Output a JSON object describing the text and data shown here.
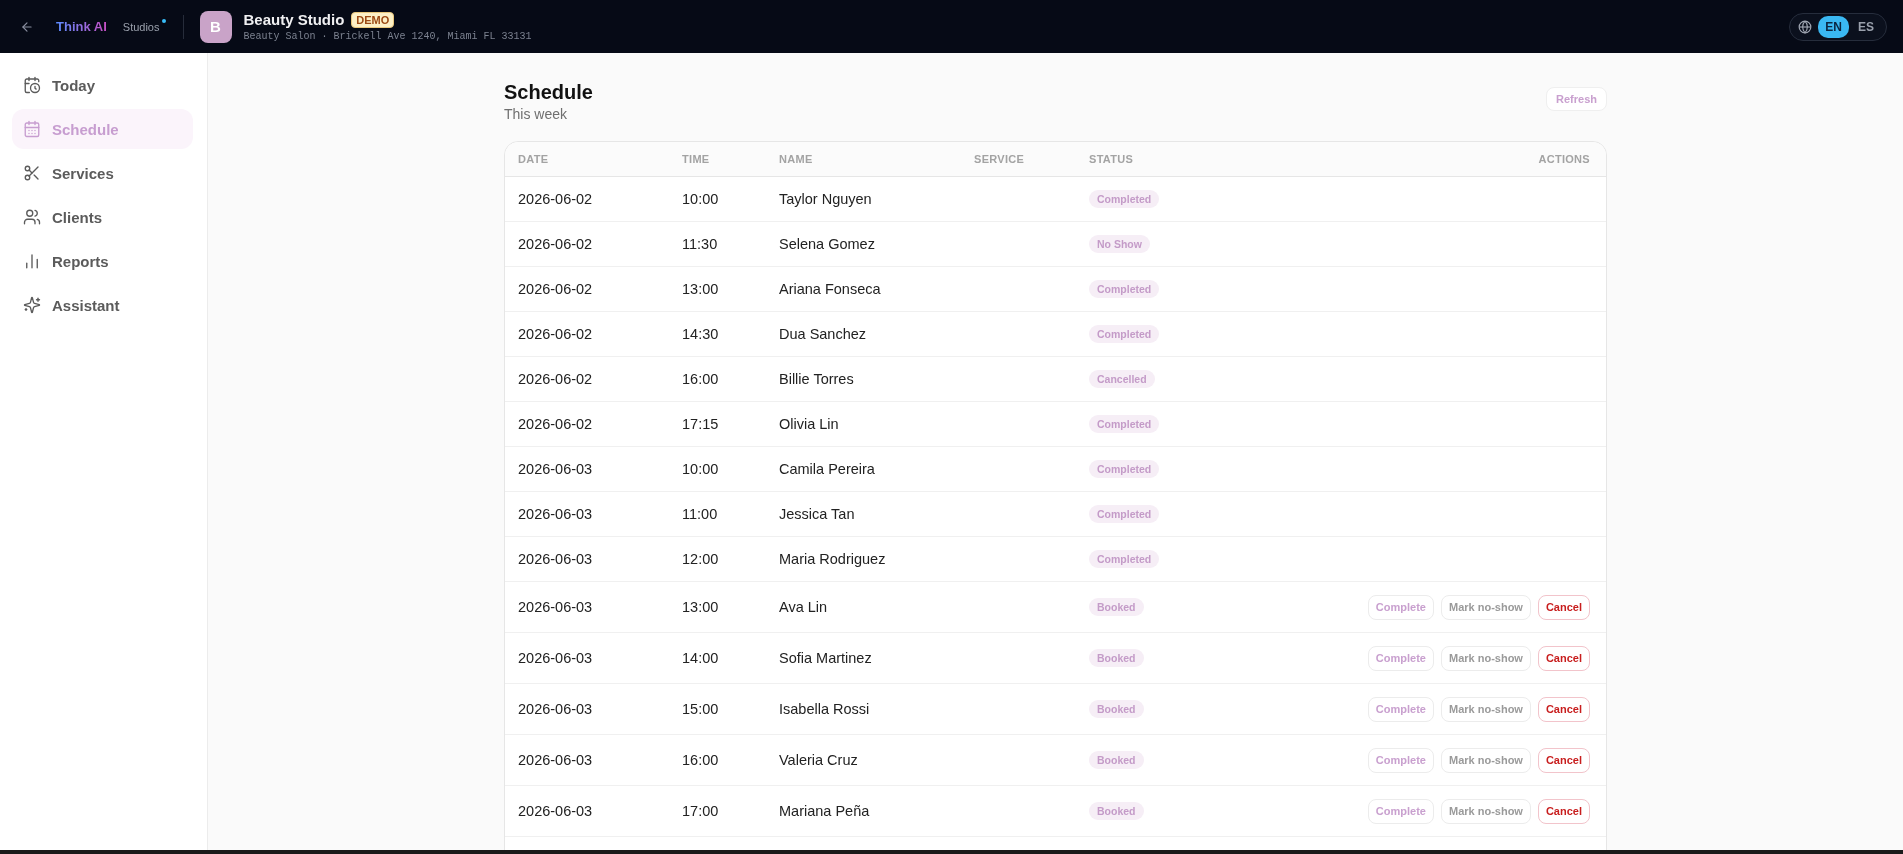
{
  "header": {
    "brand": "Think AI",
    "section": "Studios",
    "avatar_letter": "B",
    "business_name": "Beauty Studio",
    "badge": "DEMO",
    "subtitle": "Beauty Salon · Brickell Ave 1240, Miami FL 33131",
    "languages": [
      {
        "label": "EN",
        "selected": true
      },
      {
        "label": "ES",
        "selected": false
      }
    ]
  },
  "sidebar": {
    "items": [
      {
        "label": "Today",
        "selected": false
      },
      {
        "label": "Schedule",
        "selected": true
      },
      {
        "label": "Services",
        "selected": false
      },
      {
        "label": "Clients",
        "selected": false
      },
      {
        "label": "Reports",
        "selected": false
      },
      {
        "label": "Assistant",
        "selected": false
      }
    ]
  },
  "page": {
    "title": "Schedule",
    "subtitle": "This week",
    "refresh_button": "Refresh"
  },
  "table": {
    "columns": [
      "DATE",
      "TIME",
      "NAME",
      "SERVICE",
      "STATUS",
      "ACTIONS"
    ],
    "rows": [
      {
        "date": "2026-06-02",
        "time": "10:00",
        "name": "Taylor Nguyen",
        "status": "Completed"
      },
      {
        "date": "2026-06-02",
        "time": "11:30",
        "name": "Selena Gomez",
        "status": "No Show"
      },
      {
        "date": "2026-06-02",
        "time": "13:00",
        "name": "Ariana Fonseca",
        "status": "Completed"
      },
      {
        "date": "2026-06-02",
        "time": "14:30",
        "name": "Dua Sanchez",
        "status": "Completed"
      },
      {
        "date": "2026-06-02",
        "time": "16:00",
        "name": "Billie Torres",
        "status": "Cancelled"
      },
      {
        "date": "2026-06-02",
        "time": "17:15",
        "name": "Olivia Lin",
        "status": "Completed"
      },
      {
        "date": "2026-06-03",
        "time": "10:00",
        "name": "Camila Pereira",
        "status": "Completed"
      },
      {
        "date": "2026-06-03",
        "time": "11:00",
        "name": "Jessica Tan",
        "status": "Completed"
      },
      {
        "date": "2026-06-03",
        "time": "12:00",
        "name": "Maria Rodriguez",
        "status": "Completed"
      },
      {
        "date": "2026-06-03",
        "time": "13:00",
        "name": "Ava Lin",
        "status": "Booked",
        "actions": [
          {
            "label": "Complete",
            "kind": "complete"
          },
          {
            "label": "Mark no-show",
            "kind": "no_show"
          },
          {
            "label": "Cancel",
            "kind": "cancel"
          }
        ]
      },
      {
        "date": "2026-06-03",
        "time": "14:00",
        "name": "Sofia Martinez",
        "status": "Booked",
        "actions": [
          {
            "label": "Complete",
            "kind": "complete"
          },
          {
            "label": "Mark no-show",
            "kind": "no_show"
          },
          {
            "label": "Cancel",
            "kind": "cancel"
          }
        ]
      },
      {
        "date": "2026-06-03",
        "time": "15:00",
        "name": "Isabella Rossi",
        "status": "Booked",
        "actions": [
          {
            "label": "Complete",
            "kind": "complete"
          },
          {
            "label": "Mark no-show",
            "kind": "no_show"
          },
          {
            "label": "Cancel",
            "kind": "cancel"
          }
        ]
      },
      {
        "date": "2026-06-03",
        "time": "16:00",
        "name": "Valeria Cruz",
        "status": "Booked",
        "actions": [
          {
            "label": "Complete",
            "kind": "complete"
          },
          {
            "label": "Mark no-show",
            "kind": "no_show"
          },
          {
            "label": "Cancel",
            "kind": "cancel"
          }
        ]
      },
      {
        "date": "2026-06-03",
        "time": "17:00",
        "name": "Mariana Peña",
        "status": "Booked",
        "actions": [
          {
            "label": "Complete",
            "kind": "complete"
          },
          {
            "label": "Mark no-show",
            "kind": "no_show"
          },
          {
            "label": "Cancel",
            "kind": "cancel"
          }
        ]
      }
    ]
  }
}
